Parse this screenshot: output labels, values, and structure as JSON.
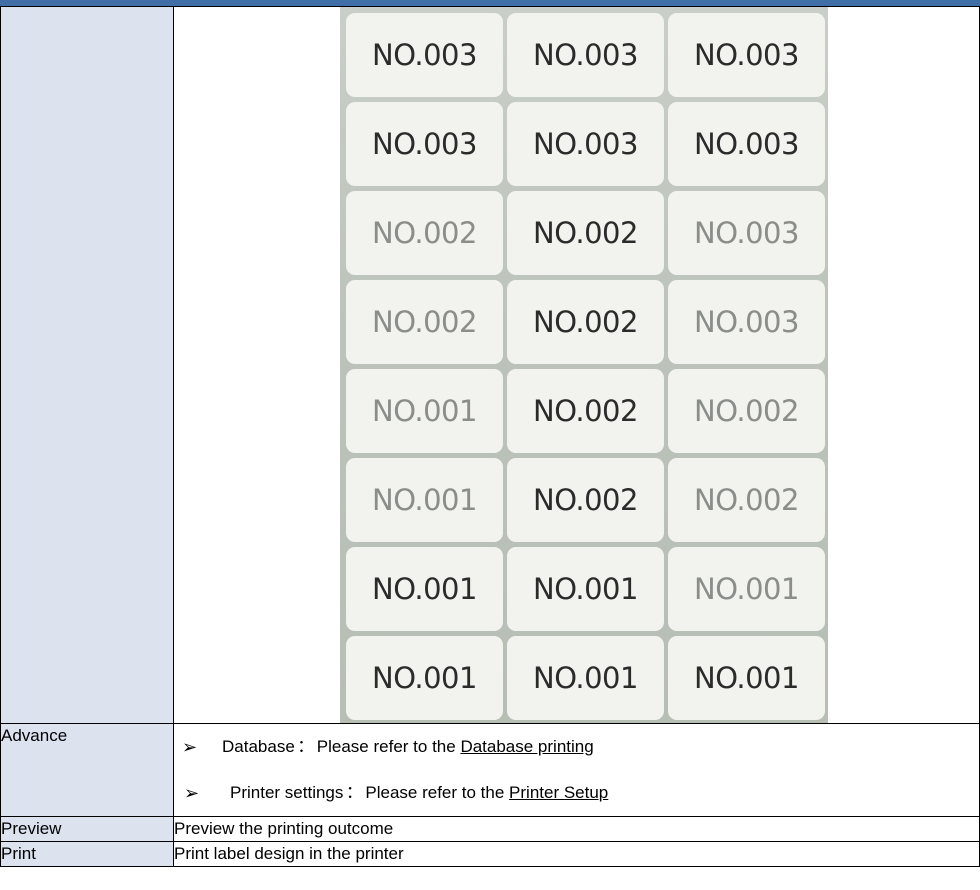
{
  "rows": {
    "advance": {
      "label": "Advance",
      "items": [
        {
          "name": "Database",
          "sep": "：",
          "text": "Please refer to the",
          "link": "Database printing"
        },
        {
          "name": "Printer settings",
          "sep": "：",
          "text": "Please refer to the",
          "link": "Printer Setup"
        }
      ]
    },
    "preview": {
      "label": "Preview",
      "text": "Preview the printing outcome"
    },
    "print": {
      "label": "Print",
      "text": "Print label design in the printer"
    }
  },
  "photo": {
    "stickers": [
      [
        "NO.003",
        "NO.003",
        "NO.003"
      ],
      [
        "NO.003",
        "NO.003",
        "NO.003"
      ],
      [
        "NO.002",
        "NO.002",
        "NO.003"
      ],
      [
        "NO.002",
        "NO.002",
        "NO.003"
      ],
      [
        "NO.001",
        "NO.002",
        "NO.002"
      ],
      [
        "NO.001",
        "NO.002",
        "NO.002"
      ],
      [
        "NO.001",
        "NO.001",
        "NO.001"
      ],
      [
        "NO.001",
        "NO.001",
        "NO.001"
      ]
    ]
  },
  "colors": {
    "label_bg": "#dce3ee",
    "header_bar": "#3f6fa6"
  }
}
